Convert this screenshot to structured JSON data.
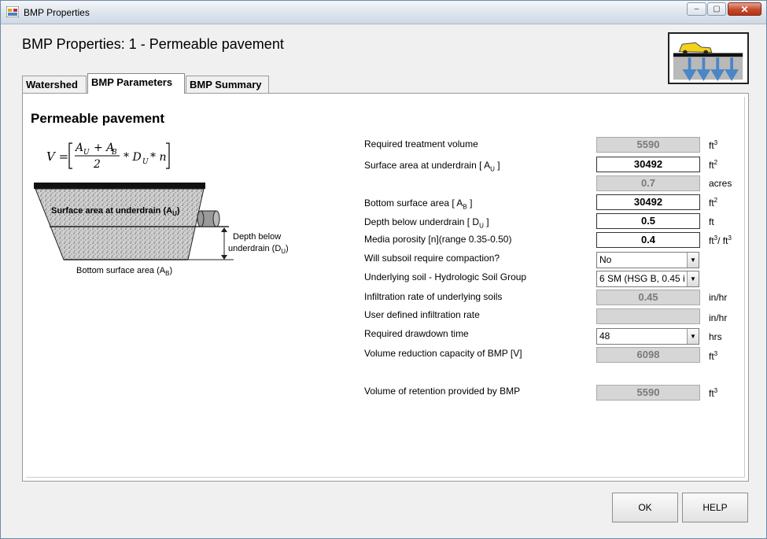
{
  "window": {
    "title": "BMP Properties",
    "minimize": "–",
    "maximize": "▢",
    "close": "✕"
  },
  "header": {
    "title": "BMP Properties: 1 - Permeable pavement"
  },
  "tabs": [
    {
      "label": "Watershed"
    },
    {
      "label": "BMP Parameters"
    },
    {
      "label": "BMP Summary"
    }
  ],
  "section": {
    "title": "Permeable pavement"
  },
  "diagram": {
    "formula_lhs": "V =",
    "numerator": "A",
    "formula_text": "V = [(A_U + A_B)/2 * D_U * n]",
    "label_top": "Surface area at underdrain (A",
    "label_top_sub": "U",
    "label_depth_1": "Depth below",
    "label_depth_2": "underdrain (D",
    "label_depth_sub": "U",
    "label_bottom": "Bottom surface area (A",
    "label_bottom_sub": "B"
  },
  "rows": [
    {
      "label": "Required treatment volume",
      "value": "5590",
      "unit": "ft",
      "unit_sup": "3"
    },
    {
      "label": "Surface area at underdrain [ A",
      "label_sub": "U",
      "label_end": " ]",
      "value": "30492",
      "unit": "ft",
      "unit_sup": "2"
    },
    {
      "value": "0.7",
      "unit": "acres"
    },
    {
      "label": "Bottom surface area [ A",
      "label_sub": "B",
      "label_end": " ]",
      "value": "30492",
      "unit": "ft",
      "unit_sup": "2"
    },
    {
      "label": "Depth below underdrain [ D",
      "label_sub": "U",
      "label_end": " ]",
      "value": "0.5",
      "unit": "ft"
    },
    {
      "label": "Media porosity [n](range 0.35-0.50)",
      "value": "0.4",
      "unit": "ft",
      "unit_sup": "3",
      "unit_mid": "/ ft",
      "unit_sup2": "3"
    },
    {
      "label": "Will subsoil require compaction?",
      "value": "No"
    },
    {
      "label": "Underlying soil - Hydrologic Soil Group",
      "value": "6 SM (HSG B, 0.45 i"
    },
    {
      "label": "Infiltration rate of underlying soils",
      "value": "0.45",
      "unit": "in/hr"
    },
    {
      "label": "User defined infiltration rate",
      "value": "",
      "unit": "in/hr"
    },
    {
      "label": "Required drawdown time",
      "value": "48",
      "unit": "hrs"
    },
    {
      "label": "Volume reduction capacity of BMP [V]",
      "value": "6098",
      "unit": "ft",
      "unit_sup": "3"
    },
    {
      "label": "Volume of retention provided by BMP",
      "value": "5590",
      "unit": "ft",
      "unit_sup": "3"
    }
  ],
  "buttons": {
    "ok": "OK",
    "help": "HELP"
  }
}
